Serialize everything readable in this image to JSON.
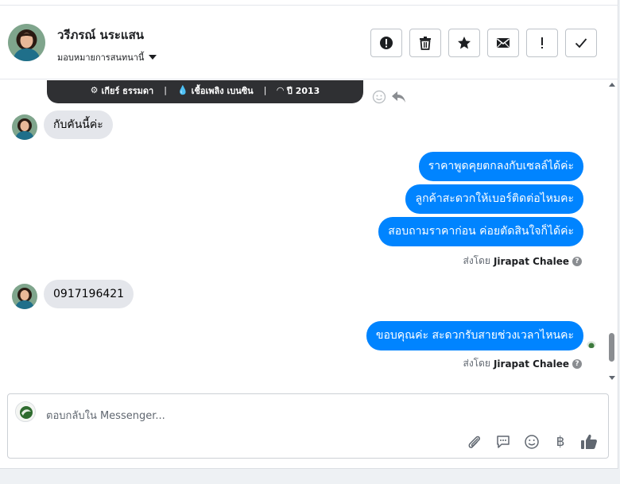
{
  "header": {
    "contact_name": "วรีภรณ์ นระแสน",
    "assign_label": "มอบหมายการสนทนานี้",
    "actions": [
      {
        "name": "spam-button",
        "icon": "exclamation-circle-icon"
      },
      {
        "name": "delete-button",
        "icon": "trash-icon"
      },
      {
        "name": "star-button",
        "icon": "star-icon"
      },
      {
        "name": "mark-unread-button",
        "icon": "envelope-icon"
      },
      {
        "name": "follow-up-button",
        "icon": "exclamation-icon"
      },
      {
        "name": "mark-done-button",
        "icon": "check-icon"
      }
    ]
  },
  "card": {
    "gear": "เกียร์ ธรรมดา",
    "fuel": "เชื้อเพลิง เบนซิน",
    "year": "ปี 2013"
  },
  "messages": [
    {
      "dir": "in",
      "text": "กับคันนี้ค่ะ"
    },
    {
      "dir": "out",
      "text": "ราคาพูดคุยตกลงกับเซลล์ได้ค่ะ"
    },
    {
      "dir": "out",
      "text": "ลูกค้าสะดวกให้เบอร์ติดต่อไหมคะ"
    },
    {
      "dir": "out",
      "text": "สอบถามราคาก่อน ค่อยตัดสินใจก็ได้ค่ะ"
    },
    {
      "dir": "in",
      "text": "0917196421"
    },
    {
      "dir": "out",
      "text": "ขอบคุณค่ะ สะดวกรับสายช่วงเวลาไหนคะ"
    }
  ],
  "sent_by": {
    "prefix": "ส่งโดย",
    "agent": "Jirapat Chalee",
    "help": "?"
  },
  "composer": {
    "placeholder": "ตอบกลับใน Messenger...",
    "currency_symbol": "฿"
  }
}
